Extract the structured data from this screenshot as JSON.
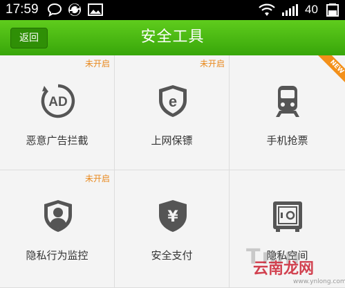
{
  "status_bar": {
    "time": "17:59",
    "battery": "40",
    "icons": [
      "chat-bubble-icon",
      "sync-icon",
      "image-icon",
      "wifi-icon",
      "signal-icon",
      "battery-icon"
    ]
  },
  "header": {
    "back_label": "返回",
    "title": "安全工具"
  },
  "colors": {
    "header_green": "#4cb814",
    "badge_orange": "#e8891e",
    "icon_gray": "#555555"
  },
  "tools": [
    {
      "label": "恶意广告拦截",
      "badge": "未开启",
      "icon": "ad-block-icon"
    },
    {
      "label": "上网保镖",
      "badge": "未开启",
      "icon": "browser-shield-icon"
    },
    {
      "label": "手机抢票",
      "badge": "NEW",
      "icon": "train-icon"
    },
    {
      "label": "隐私行为监控",
      "badge": "未开启",
      "icon": "privacy-monitor-icon"
    },
    {
      "label": "安全支付",
      "badge": "",
      "icon": "secure-pay-icon"
    },
    {
      "label": "隐私空间",
      "badge": "",
      "icon": "safe-box-icon"
    }
  ],
  "watermark": {
    "logo": "云南龙网",
    "url": "www.ynlong.com",
    "ghost": "Tmn"
  }
}
